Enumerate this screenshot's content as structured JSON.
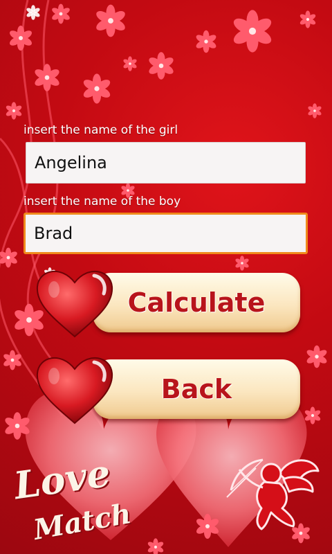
{
  "form": {
    "girl_label": "insert the name of the girl",
    "girl_value": "Angelina",
    "boy_label": "insert the name of the boy",
    "boy_value": "Brad"
  },
  "buttons": {
    "calculate_label": "Calculate",
    "back_label": "Back"
  },
  "branding": {
    "line1": "Love",
    "line2": "Match"
  },
  "colors": {
    "background": "#c30a12",
    "focus_border": "#f08a1c",
    "button_text": "#b8141b"
  },
  "icons": [
    "flower-pattern",
    "big-heart",
    "heart-icon",
    "cupid-icon"
  ]
}
